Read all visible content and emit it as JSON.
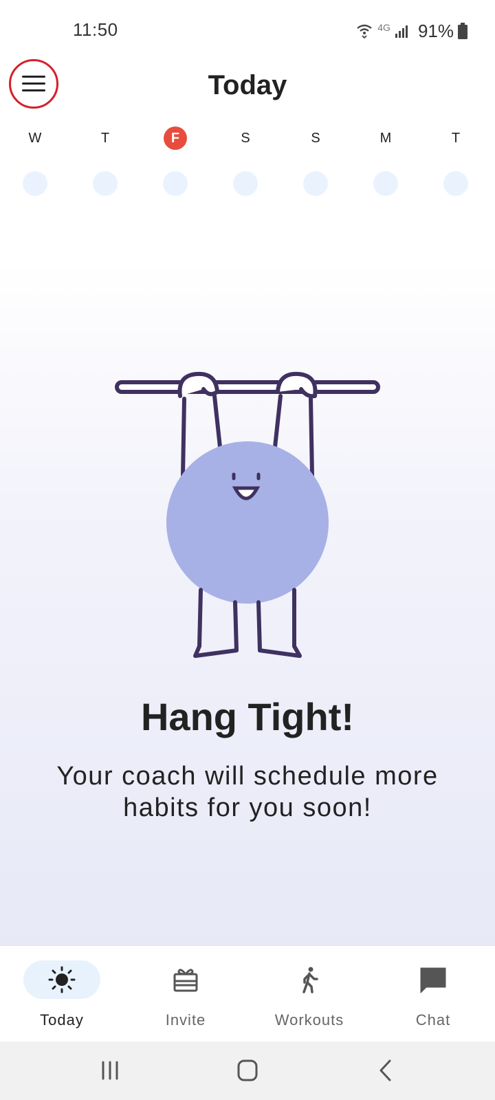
{
  "status_bar": {
    "time": "11:50",
    "network": "4G",
    "battery": "91%",
    "icons": [
      "wifi-calling-icon",
      "signal-bars-icon",
      "battery-icon"
    ]
  },
  "header": {
    "title": "Today",
    "menu_icon": "hamburger-menu-icon"
  },
  "week": {
    "days": [
      {
        "letter": "W",
        "active": false
      },
      {
        "letter": "T",
        "active": false
      },
      {
        "letter": "F",
        "active": true
      },
      {
        "letter": "S",
        "active": false
      },
      {
        "letter": "S",
        "active": false
      },
      {
        "letter": "M",
        "active": false
      },
      {
        "letter": "T",
        "active": false
      }
    ]
  },
  "main": {
    "title": "Hang Tight!",
    "message": "Your coach will schedule more habits for you soon!"
  },
  "bottom_nav": {
    "items": [
      {
        "label": "Today",
        "icon": "sun-icon",
        "active": true
      },
      {
        "label": "Invite",
        "icon": "gift-icon",
        "active": false
      },
      {
        "label": "Workouts",
        "icon": "walking-person-icon",
        "active": false
      },
      {
        "label": "Chat",
        "icon": "chat-bubble-icon",
        "active": false
      }
    ]
  },
  "system_nav": {
    "items": [
      "recent-apps-icon",
      "home-icon",
      "back-icon"
    ]
  },
  "colors": {
    "accent": "#e84c3d",
    "character_body": "#a7b1e6",
    "character_line": "#3f3160",
    "day_dot": "#eaf3fd",
    "nav_active_bg": "#e8f2fd"
  }
}
